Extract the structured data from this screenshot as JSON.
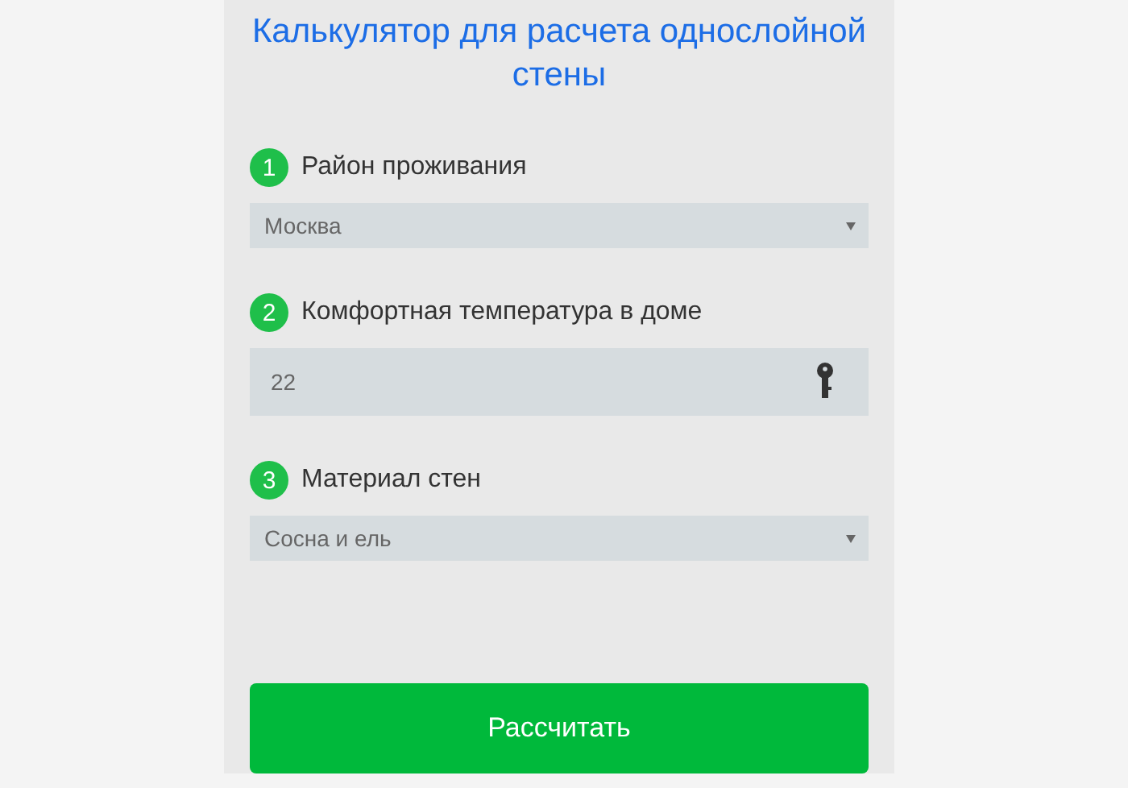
{
  "title": "Калькулятор для расчета однослойной стены",
  "steps": [
    {
      "number": "1",
      "label": "Район проживания",
      "kind": "select",
      "value": "Москва"
    },
    {
      "number": "2",
      "label": "Комфортная температура в доме",
      "kind": "input",
      "value": "22"
    },
    {
      "number": "3",
      "label": "Материал стен",
      "kind": "select",
      "value": "Сосна и ель"
    }
  ],
  "button": "Рассчитать"
}
